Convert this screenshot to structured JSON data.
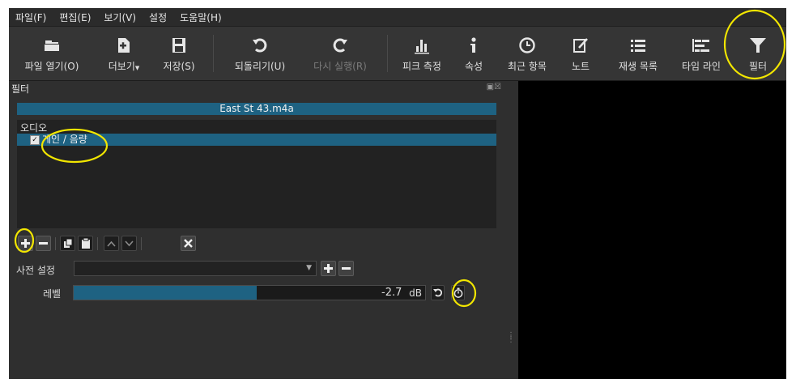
{
  "menu": [
    "파일(F)",
    "편집(E)",
    "보기(V)",
    "설정",
    "도움말(H)"
  ],
  "toolbar": [
    {
      "label": "파일 열기(O)",
      "icon": "folder-icon",
      "enabled": true
    },
    {
      "label": "더보기",
      "icon": "add-document-icon",
      "enabled": true
    },
    {
      "label": "저장(S)",
      "icon": "save-icon",
      "enabled": true
    },
    {
      "label": "되돌리기(U)",
      "icon": "undo-icon",
      "enabled": true
    },
    {
      "label": "다시 실행(R)",
      "icon": "redo-icon",
      "enabled": false
    },
    {
      "label": "피크 측정",
      "icon": "peak-meter-icon",
      "enabled": true
    },
    {
      "label": "속성",
      "icon": "info-icon",
      "enabled": true
    },
    {
      "label": "최근 항목",
      "icon": "clock-icon",
      "enabled": true
    },
    {
      "label": "노트",
      "icon": "note-icon",
      "enabled": true
    },
    {
      "label": "재생 목록",
      "icon": "playlist-icon",
      "enabled": true
    },
    {
      "label": "타임 라인",
      "icon": "timeline-icon",
      "enabled": true
    },
    {
      "label": "필터",
      "icon": "filter-icon",
      "enabled": true
    }
  ],
  "filters_panel": {
    "title": "필터",
    "clip_name": "East St 43.m4a",
    "list_header": "오디오",
    "filters": [
      {
        "name": "게인 / 음량",
        "checked": true
      }
    ]
  },
  "presets": {
    "label": "사전 설정",
    "value": ""
  },
  "level": {
    "label": "레벨",
    "value": "-2.7",
    "unit": "dB",
    "fill_fraction": 0.52
  },
  "colors": {
    "accent": "#1e6282",
    "annotation": "#f2e600",
    "background": "#2f2f2f"
  }
}
